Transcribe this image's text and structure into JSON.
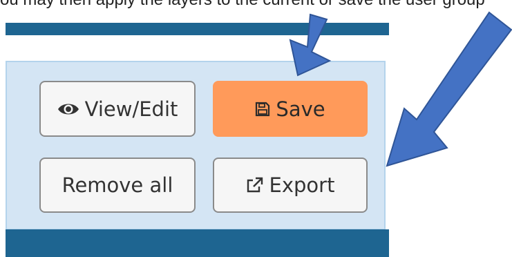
{
  "caption": {
    "text": "ou may then apply the layers to the current or save the user group"
  },
  "buttons": {
    "view_edit": "View/Edit",
    "save": "Save",
    "remove_all": "Remove all",
    "export": "Export"
  },
  "icons": {
    "view_edit": "eye-icon",
    "save": "floppy-disk-icon",
    "export": "external-link-icon"
  },
  "colors": {
    "bar": "#1e6591",
    "panel": "#d4e5f4",
    "save_button": "#ff9a5a",
    "arrow": "#4472c4"
  }
}
